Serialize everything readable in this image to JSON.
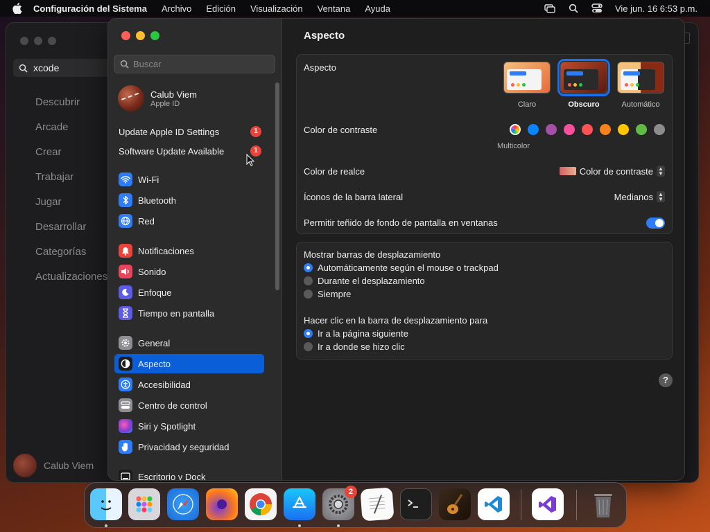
{
  "menubar": {
    "app_name": "Configuración del Sistema",
    "items": [
      "Archivo",
      "Edición",
      "Visualización",
      "Ventana",
      "Ayuda"
    ],
    "clock": "Vie jun. 16  6:53 p.m."
  },
  "background_app": {
    "search_value": "xcode",
    "nav": [
      "Descubrir",
      "Arcade",
      "Crear",
      "Trabajar",
      "Jugar",
      "Desarrollar",
      "Categorías",
      "Actualizaciones"
    ],
    "user_name": "Calub Viem"
  },
  "sidebar": {
    "search_placeholder": "Buscar",
    "account": {
      "name": "Calub Viem",
      "subtitle": "Apple ID"
    },
    "notices": [
      {
        "label": "Update Apple ID Settings",
        "badge": "1"
      },
      {
        "label": "Software Update Available",
        "badge": "1"
      }
    ],
    "items": [
      {
        "label": "Wi-Fi",
        "icon": "wifi-icon",
        "color": "#2e7cf6"
      },
      {
        "label": "Bluetooth",
        "icon": "bluetooth-icon",
        "color": "#2e7cf6"
      },
      {
        "label": "Red",
        "icon": "globe-icon",
        "color": "#2e7cf6"
      },
      {
        "label": "Notificaciones",
        "icon": "bell-icon",
        "color": "#e8443a"
      },
      {
        "label": "Sonido",
        "icon": "speaker-icon",
        "color": "#e8445a"
      },
      {
        "label": "Enfoque",
        "icon": "moon-icon",
        "color": "#5e5ce6"
      },
      {
        "label": "Tiempo en pantalla",
        "icon": "hourglass-icon",
        "color": "#5e5ce6"
      },
      {
        "label": "General",
        "icon": "gear-icon",
        "color": "#8e8e93"
      },
      {
        "label": "Aspecto",
        "icon": "appearance-icon",
        "color": "#1c1c1e"
      },
      {
        "label": "Accesibilidad",
        "icon": "accessibility-icon",
        "color": "#2e7cf6"
      },
      {
        "label": "Centro de control",
        "icon": "control-center-icon",
        "color": "#8e8e93"
      },
      {
        "label": "Siri y Spotlight",
        "icon": "siri-icon",
        "color": "#7a3cd6"
      },
      {
        "label": "Privacidad y seguridad",
        "icon": "hand-icon",
        "color": "#2e7cf6"
      },
      {
        "label": "Escritorio y Dock",
        "icon": "dock-icon",
        "color": "#1c1c1e"
      }
    ],
    "selected": "Aspecto"
  },
  "content": {
    "title": "Aspecto",
    "appearance": {
      "label": "Aspecto",
      "options": [
        "Claro",
        "Obscuro",
        "Automático"
      ],
      "selected": "Obscuro"
    },
    "accent": {
      "label": "Color de contraste",
      "colors": [
        "#0a84ff",
        "#a550a7",
        "#f74f9e",
        "#ff5257",
        "#f7821b",
        "#ffc600",
        "#62ba46",
        "#8c8c8c"
      ],
      "multicolor_label": "Multicolor"
    },
    "highlight": {
      "label": "Color de realce",
      "value": "Color de contraste"
    },
    "sidebar_icons": {
      "label": "Íconos de la barra lateral",
      "value": "Medianos"
    },
    "tinting": {
      "label": "Permitir teñido de fondo de pantalla en ventanas",
      "on": true
    },
    "scroll_bars": {
      "title": "Mostrar barras de desplazamiento",
      "options": [
        "Automáticamente según el mouse o trackpad",
        "Durante el desplazamiento",
        "Siempre"
      ],
      "selected": 0
    },
    "scroll_click": {
      "title": "Hacer clic en la barra de desplazamiento para",
      "options": [
        "Ir a la página siguiente",
        "Ir a donde se hizo clic"
      ],
      "selected": 0
    },
    "help": "?"
  },
  "dock": {
    "apps": [
      "Finder",
      "Launchpad",
      "Safari",
      "Firefox",
      "Chrome",
      "App Store",
      "Configuración del Sistema",
      "TextEdit",
      "Terminal",
      "GarageBand",
      "Visual Studio Code",
      "Visual Studio",
      "Papelera"
    ],
    "settings_badge": "2"
  }
}
